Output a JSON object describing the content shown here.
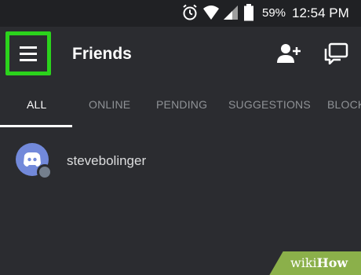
{
  "status_bar": {
    "battery_percent": "59%",
    "time": "12:54 PM",
    "icons": [
      "alarm-icon",
      "wifi-icon",
      "signal-icon",
      "battery-icon"
    ]
  },
  "header": {
    "title": "Friends",
    "menu_icon": "hamburger-menu-icon",
    "actions": [
      "add-friend-icon",
      "new-group-dm-icon"
    ],
    "highlight_color": "#2bd31c"
  },
  "tabs": [
    {
      "label": "ALL",
      "active": true
    },
    {
      "label": "ONLINE",
      "active": false
    },
    {
      "label": "PENDING",
      "active": false
    },
    {
      "label": "SUGGESTIONS",
      "active": false
    },
    {
      "label": "BLOCK",
      "active": false
    }
  ],
  "friends": [
    {
      "username": "stevebolinger",
      "status": "offline"
    }
  ],
  "watermark": {
    "part1": "wiki",
    "part2": "How"
  },
  "colors": {
    "background": "#2b2c30",
    "status_bar": "#202124",
    "avatar": "#7289da",
    "watermark": "#8bb04a"
  }
}
